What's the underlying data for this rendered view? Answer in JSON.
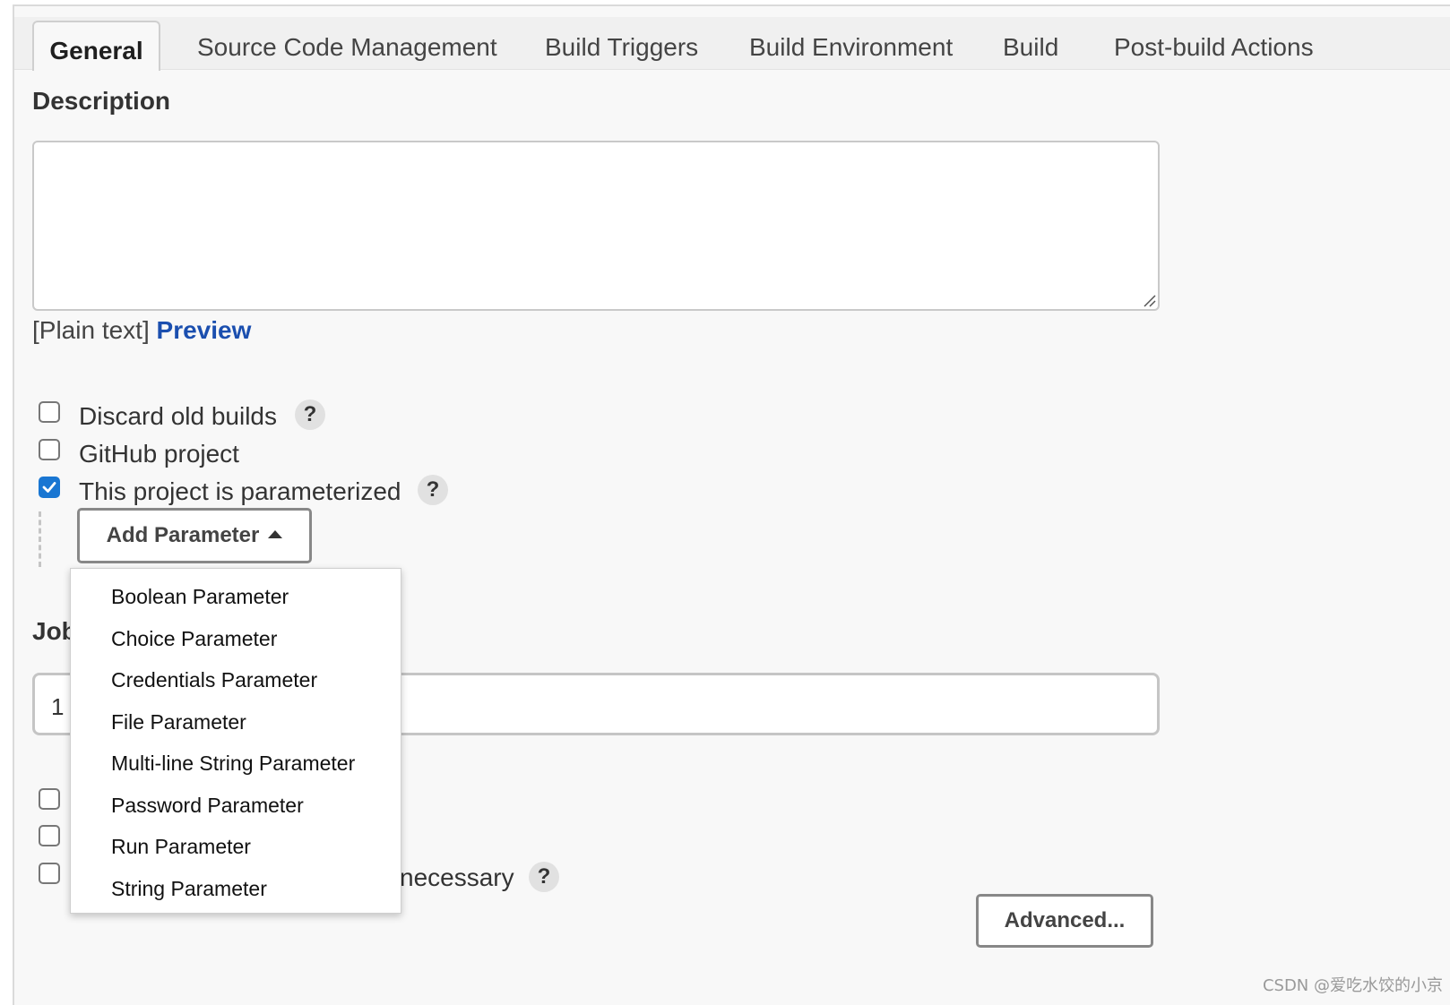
{
  "tabs": [
    {
      "label": "General",
      "active": true
    },
    {
      "label": "Source Code Management",
      "active": false
    },
    {
      "label": "Build Triggers",
      "active": false
    },
    {
      "label": "Build Environment",
      "active": false
    },
    {
      "label": "Build",
      "active": false
    },
    {
      "label": "Post-build Actions",
      "active": false
    }
  ],
  "description": {
    "label": "Description",
    "value": "",
    "format_label": "[Plain text]",
    "preview_link": "Preview"
  },
  "options": [
    {
      "label": "Discard old builds",
      "checked": false,
      "help": "?"
    },
    {
      "label": "GitHub project",
      "checked": false
    },
    {
      "label": "This project is parameterized",
      "checked": true,
      "help": "?"
    }
  ],
  "add_parameter": {
    "button_label": "Add Parameter",
    "menu_items": [
      "Boolean Parameter",
      "Choice Parameter",
      "Credentials Parameter",
      "File Parameter",
      "Multi-line String Parameter",
      "Password Parameter",
      "Run Parameter",
      "String Parameter"
    ]
  },
  "job_section": {
    "label_partial": "Job",
    "input_value": "1"
  },
  "lower_options": [
    {
      "label": "",
      "checked": false
    },
    {
      "label": "",
      "checked": false
    },
    {
      "label_partial": "necessary",
      "checked": false,
      "help": "?"
    }
  ],
  "advanced_button": "Advanced...",
  "watermark": "CSDN @爱吃水饺的小京",
  "colors": {
    "link": "#1b4faf",
    "checkbox_checked": "#1976d2",
    "page_bg": "#f8f8f8",
    "tabbar_bg": "#f0f0f0"
  }
}
